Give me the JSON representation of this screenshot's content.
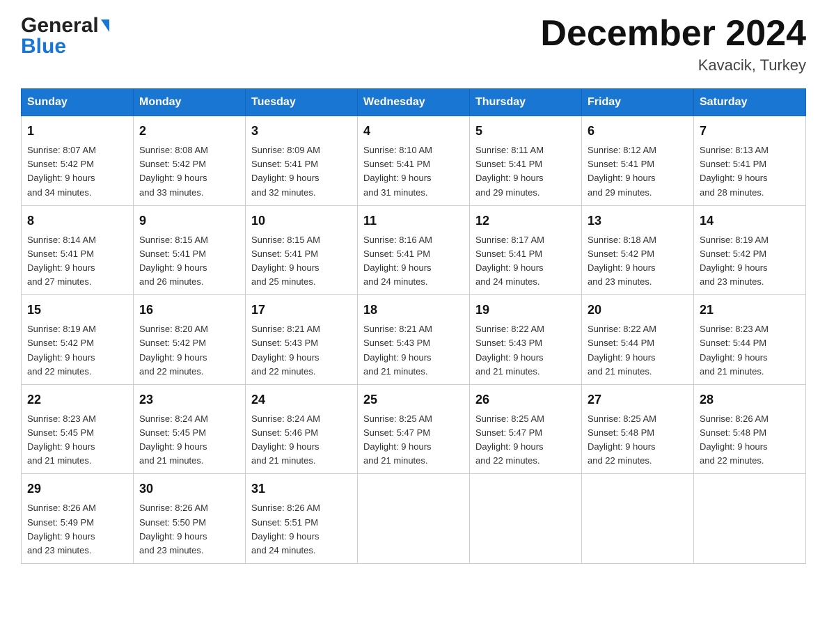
{
  "header": {
    "title": "December 2024",
    "location": "Kavacik, Turkey",
    "logo_general": "General",
    "logo_blue": "Blue"
  },
  "weekdays": [
    "Sunday",
    "Monday",
    "Tuesday",
    "Wednesday",
    "Thursday",
    "Friday",
    "Saturday"
  ],
  "weeks": [
    [
      {
        "day": "1",
        "sunrise": "8:07 AM",
        "sunset": "5:42 PM",
        "daylight": "9 hours and 34 minutes."
      },
      {
        "day": "2",
        "sunrise": "8:08 AM",
        "sunset": "5:42 PM",
        "daylight": "9 hours and 33 minutes."
      },
      {
        "day": "3",
        "sunrise": "8:09 AM",
        "sunset": "5:41 PM",
        "daylight": "9 hours and 32 minutes."
      },
      {
        "day": "4",
        "sunrise": "8:10 AM",
        "sunset": "5:41 PM",
        "daylight": "9 hours and 31 minutes."
      },
      {
        "day": "5",
        "sunrise": "8:11 AM",
        "sunset": "5:41 PM",
        "daylight": "9 hours and 29 minutes."
      },
      {
        "day": "6",
        "sunrise": "8:12 AM",
        "sunset": "5:41 PM",
        "daylight": "9 hours and 29 minutes."
      },
      {
        "day": "7",
        "sunrise": "8:13 AM",
        "sunset": "5:41 PM",
        "daylight": "9 hours and 28 minutes."
      }
    ],
    [
      {
        "day": "8",
        "sunrise": "8:14 AM",
        "sunset": "5:41 PM",
        "daylight": "9 hours and 27 minutes."
      },
      {
        "day": "9",
        "sunrise": "8:15 AM",
        "sunset": "5:41 PM",
        "daylight": "9 hours and 26 minutes."
      },
      {
        "day": "10",
        "sunrise": "8:15 AM",
        "sunset": "5:41 PM",
        "daylight": "9 hours and 25 minutes."
      },
      {
        "day": "11",
        "sunrise": "8:16 AM",
        "sunset": "5:41 PM",
        "daylight": "9 hours and 24 minutes."
      },
      {
        "day": "12",
        "sunrise": "8:17 AM",
        "sunset": "5:41 PM",
        "daylight": "9 hours and 24 minutes."
      },
      {
        "day": "13",
        "sunrise": "8:18 AM",
        "sunset": "5:42 PM",
        "daylight": "9 hours and 23 minutes."
      },
      {
        "day": "14",
        "sunrise": "8:19 AM",
        "sunset": "5:42 PM",
        "daylight": "9 hours and 23 minutes."
      }
    ],
    [
      {
        "day": "15",
        "sunrise": "8:19 AM",
        "sunset": "5:42 PM",
        "daylight": "9 hours and 22 minutes."
      },
      {
        "day": "16",
        "sunrise": "8:20 AM",
        "sunset": "5:42 PM",
        "daylight": "9 hours and 22 minutes."
      },
      {
        "day": "17",
        "sunrise": "8:21 AM",
        "sunset": "5:43 PM",
        "daylight": "9 hours and 22 minutes."
      },
      {
        "day": "18",
        "sunrise": "8:21 AM",
        "sunset": "5:43 PM",
        "daylight": "9 hours and 21 minutes."
      },
      {
        "day": "19",
        "sunrise": "8:22 AM",
        "sunset": "5:43 PM",
        "daylight": "9 hours and 21 minutes."
      },
      {
        "day": "20",
        "sunrise": "8:22 AM",
        "sunset": "5:44 PM",
        "daylight": "9 hours and 21 minutes."
      },
      {
        "day": "21",
        "sunrise": "8:23 AM",
        "sunset": "5:44 PM",
        "daylight": "9 hours and 21 minutes."
      }
    ],
    [
      {
        "day": "22",
        "sunrise": "8:23 AM",
        "sunset": "5:45 PM",
        "daylight": "9 hours and 21 minutes."
      },
      {
        "day": "23",
        "sunrise": "8:24 AM",
        "sunset": "5:45 PM",
        "daylight": "9 hours and 21 minutes."
      },
      {
        "day": "24",
        "sunrise": "8:24 AM",
        "sunset": "5:46 PM",
        "daylight": "9 hours and 21 minutes."
      },
      {
        "day": "25",
        "sunrise": "8:25 AM",
        "sunset": "5:47 PM",
        "daylight": "9 hours and 21 minutes."
      },
      {
        "day": "26",
        "sunrise": "8:25 AM",
        "sunset": "5:47 PM",
        "daylight": "9 hours and 22 minutes."
      },
      {
        "day": "27",
        "sunrise": "8:25 AM",
        "sunset": "5:48 PM",
        "daylight": "9 hours and 22 minutes."
      },
      {
        "day": "28",
        "sunrise": "8:26 AM",
        "sunset": "5:48 PM",
        "daylight": "9 hours and 22 minutes."
      }
    ],
    [
      {
        "day": "29",
        "sunrise": "8:26 AM",
        "sunset": "5:49 PM",
        "daylight": "9 hours and 23 minutes."
      },
      {
        "day": "30",
        "sunrise": "8:26 AM",
        "sunset": "5:50 PM",
        "daylight": "9 hours and 23 minutes."
      },
      {
        "day": "31",
        "sunrise": "8:26 AM",
        "sunset": "5:51 PM",
        "daylight": "9 hours and 24 minutes."
      },
      null,
      null,
      null,
      null
    ]
  ]
}
